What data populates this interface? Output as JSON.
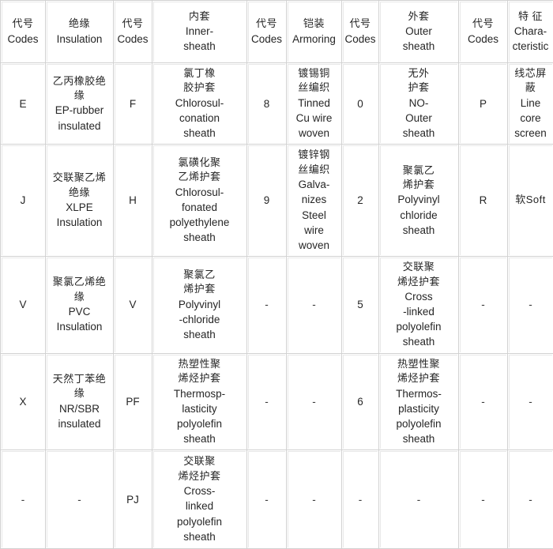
{
  "table": {
    "headers": [
      {
        "cn": "代号",
        "en": "Codes"
      },
      {
        "cn": "绝缘",
        "en": "Insulation"
      },
      {
        "cn": "代号",
        "en": "Codes"
      },
      {
        "cn": "内套",
        "en": "Inner-\nsheath"
      },
      {
        "cn": "代号",
        "en": "Codes"
      },
      {
        "cn": "铠装",
        "en": "Armoring"
      },
      {
        "cn": "代号",
        "en": "Codes"
      },
      {
        "cn": "外套",
        "en": "Outer\nsheath"
      },
      {
        "cn": "代号",
        "en": "Codes"
      },
      {
        "cn": "特 征",
        "en": "Chara-\ncteristic"
      }
    ],
    "rows": [
      [
        {
          "cn": "",
          "en": "E"
        },
        {
          "cn": "乙丙橡胶绝\n缘",
          "en": "EP-rubber\ninsulated"
        },
        {
          "cn": "",
          "en": "F"
        },
        {
          "cn": "氯丁橡\n胶护套",
          "en": "Chlorosul-\nconation\nsheath"
        },
        {
          "cn": "",
          "en": "8"
        },
        {
          "cn": "镀锡铜\n丝编织",
          "en": "Tinned\nCu wire\nwoven"
        },
        {
          "cn": "",
          "en": "0"
        },
        {
          "cn": "无外\n护套",
          "en": "NO-\nOuter\nsheath"
        },
        {
          "cn": "",
          "en": "P"
        },
        {
          "cn": "线芯屏\n蔽",
          "en": "Line\ncore\nscreen"
        }
      ],
      [
        {
          "cn": "",
          "en": "J"
        },
        {
          "cn": "交联聚乙烯\n绝缘",
          "en": "XLPE\nInsulation"
        },
        {
          "cn": "",
          "en": "H"
        },
        {
          "cn": "氯磺化聚\n乙烯护套",
          "en": "Chlorosul-\nfonated\npolyethylene\nsheath"
        },
        {
          "cn": "",
          "en": "9"
        },
        {
          "cn": "镀锌钢\n丝编织",
          "en": "Galva-\nnizes\nSteel\nwire\nwoven"
        },
        {
          "cn": "",
          "en": "2"
        },
        {
          "cn": "聚氯乙\n烯护套",
          "en": "Polyvinyl\nchloride\nsheath"
        },
        {
          "cn": "",
          "en": "R"
        },
        {
          "cn": "软Soft",
          "en": ""
        }
      ],
      [
        {
          "cn": "",
          "en": "V"
        },
        {
          "cn": "聚氯乙烯绝\n缘",
          "en": "PVC\nInsulation"
        },
        {
          "cn": "",
          "en": "V"
        },
        {
          "cn": "聚氯乙\n烯护套",
          "en": "Polyvinyl\n-chloride\nsheath"
        },
        {
          "cn": "",
          "en": "-"
        },
        {
          "cn": "",
          "en": "-"
        },
        {
          "cn": "",
          "en": "5"
        },
        {
          "cn": "交联聚\n烯烃护套",
          "en": "Cross\n-linked\npolyolefin\nsheath"
        },
        {
          "cn": "",
          "en": "-"
        },
        {
          "cn": "",
          "en": "-"
        }
      ],
      [
        {
          "cn": "",
          "en": "X"
        },
        {
          "cn": "天然丁苯绝\n缘",
          "en": "NR/SBR\ninsulated"
        },
        {
          "cn": "",
          "en": "PF"
        },
        {
          "cn": "热塑性聚\n烯烃护套",
          "en": "Thermosp-\nlasticity\npolyolefin\nsheath"
        },
        {
          "cn": "",
          "en": "-"
        },
        {
          "cn": "",
          "en": "-"
        },
        {
          "cn": "",
          "en": "6"
        },
        {
          "cn": "热塑性聚\n烯烃护套",
          "en": "Thermos-\nplasticity\npolyolefin\nsheath"
        },
        {
          "cn": "",
          "en": "-"
        },
        {
          "cn": "",
          "en": "-"
        }
      ],
      [
        {
          "cn": "",
          "en": "-"
        },
        {
          "cn": "",
          "en": "-"
        },
        {
          "cn": "",
          "en": "PJ"
        },
        {
          "cn": "交联聚\n烯烃护套",
          "en": "Cross-\nlinked\npolyolefin\nsheath"
        },
        {
          "cn": "",
          "en": "-"
        },
        {
          "cn": "",
          "en": "-"
        },
        {
          "cn": "",
          "en": "-"
        },
        {
          "cn": "",
          "en": "-"
        },
        {
          "cn": "",
          "en": "-"
        },
        {
          "cn": "",
          "en": "-"
        }
      ]
    ]
  },
  "style": {
    "border_color": "#d2d2d2",
    "text_color": "#262626",
    "background": "#ffffff"
  }
}
